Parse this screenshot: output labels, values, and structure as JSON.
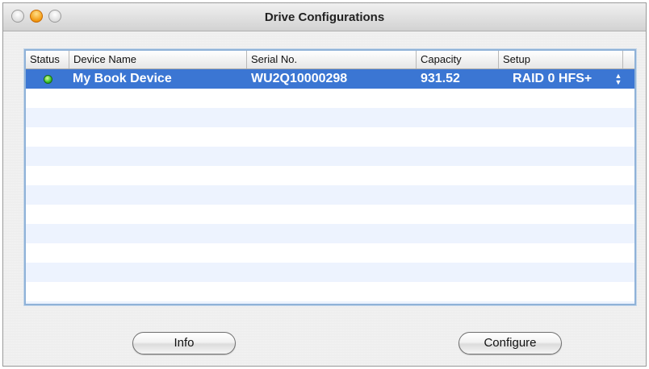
{
  "window": {
    "title": "Drive Configurations"
  },
  "table": {
    "columns": [
      "Status",
      "Device Name",
      "Serial No.",
      "Capacity",
      "Setup"
    ],
    "rows": [
      {
        "status_icon": "green-status-icon",
        "name": "My Book Device",
        "serial": "WU2Q10000298",
        "capacity": "931.52",
        "setup": "RAID 0 HFS+"
      }
    ]
  },
  "buttons": {
    "info": "Info",
    "configure": "Configure"
  },
  "colors": {
    "selection": "#3b76d3",
    "alt_row": "#edf3fe",
    "status_ok": "#37c12a"
  }
}
